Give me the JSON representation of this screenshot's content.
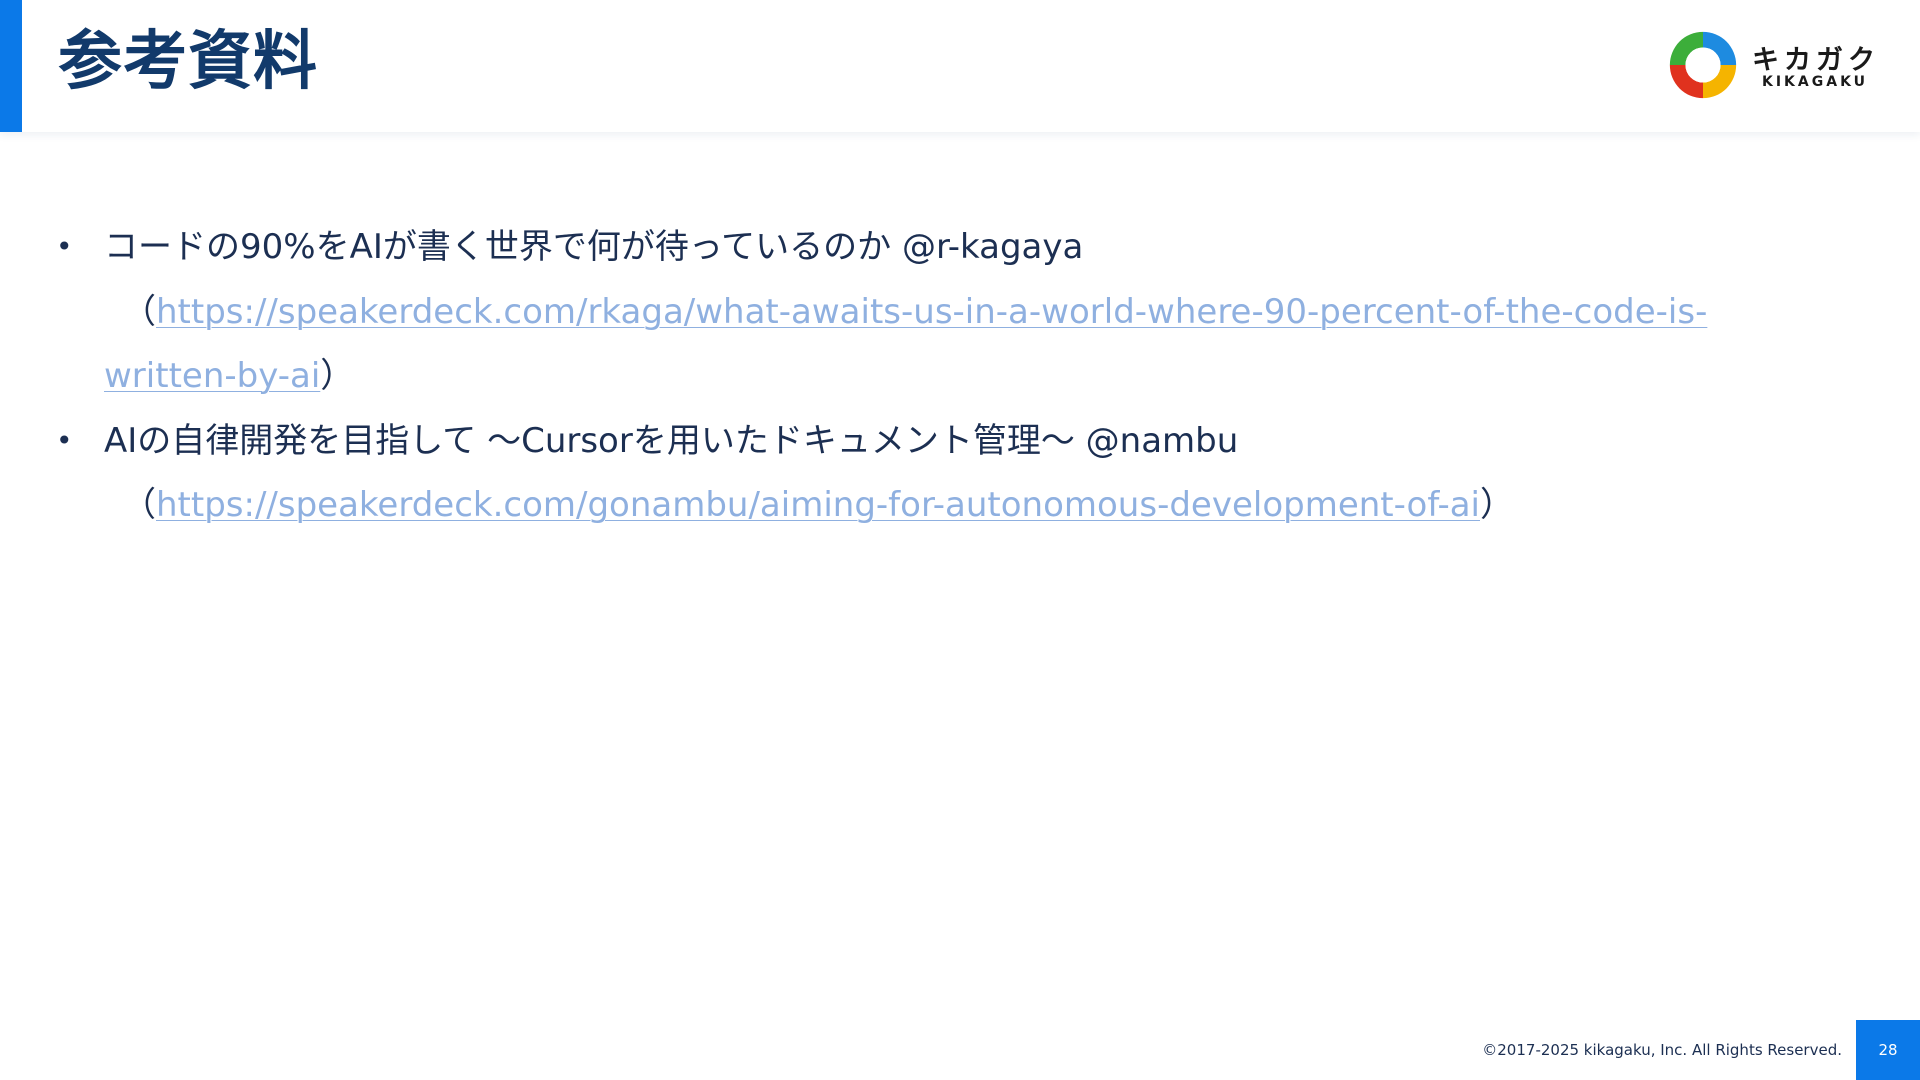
{
  "slide": {
    "title": "参考資料",
    "accent_color": "#0b79e8",
    "title_color": "#123a6b",
    "link_color": "#8fb0e0"
  },
  "logo": {
    "text_jp": "キカガク",
    "text_en": "KIKAGAKU"
  },
  "references": [
    {
      "bullet": "•",
      "text": "コードの90%をAIが書く世界で何が待っているのか @r-kagaya",
      "open_paren": "（",
      "url_part1": "https://speakerdeck.com/rkaga/what-awaits-us-in-a-world-where-90-percent-of-the-code-is-",
      "url_part2": "written-by-ai",
      "close_paren": "）"
    },
    {
      "bullet": "•",
      "text": "AIの自律開発を目指して ～Cursorを用いたドキュメント管理～ @nambu",
      "open_paren": "（",
      "url": "https://speakerdeck.com/gonambu/aiming-for-autonomous-development-of-ai",
      "close_paren": "）"
    }
  ],
  "footer": {
    "copyright": "©2017-2025 kikagaku, Inc. All Rights Reserved.",
    "page_number": "28"
  }
}
